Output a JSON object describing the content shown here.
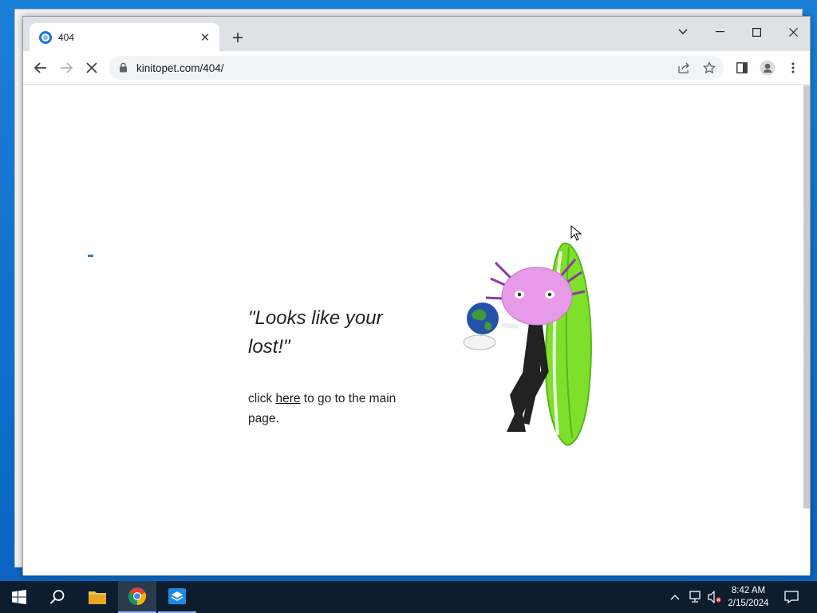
{
  "browser": {
    "tab_title": "404",
    "url": "kinitopet.com/404/"
  },
  "page": {
    "quote": "\"Looks like your lost!\"",
    "click_prefix": "click ",
    "click_link": "here",
    "click_suffix": " to go to the main page."
  },
  "taskbar": {
    "time": "8:42 AM",
    "date": "2/15/2024"
  },
  "colors": {
    "desktop": "#0e6fcc",
    "taskbar": "#0b1d2f",
    "character_pink": "#e79ae8",
    "surfboard_green": "#7ee02a"
  }
}
